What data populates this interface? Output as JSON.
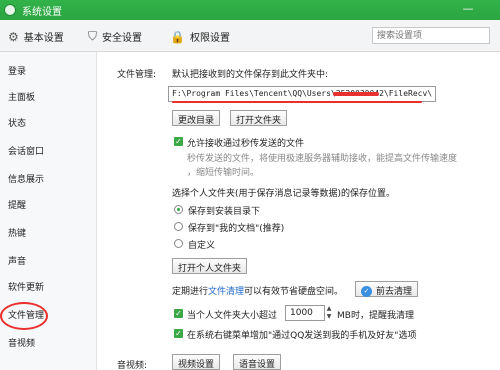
{
  "window": {
    "title": "系统设置",
    "minimize": "—"
  },
  "tabs": [
    {
      "label": "基本设置",
      "icon": "gear-icon"
    },
    {
      "label": "安全设置",
      "icon": "shield-icon"
    },
    {
      "label": "权限设置",
      "icon": "lock-icon"
    }
  ],
  "search": {
    "placeholder": "搜索设置项"
  },
  "sidebar": {
    "items": [
      {
        "label": "登录"
      },
      {
        "label": "主面板"
      },
      {
        "label": "状态"
      },
      {
        "label": "会话窗口"
      },
      {
        "label": "信息展示"
      },
      {
        "label": "提醒"
      },
      {
        "label": "热键"
      },
      {
        "label": "声音"
      },
      {
        "label": "软件更新"
      },
      {
        "label": "文件管理"
      },
      {
        "label": "音视频"
      }
    ],
    "selected": "文件管理"
  },
  "file_mgmt": {
    "section_label": "文件管理:",
    "save_desc": "默认把接收到的文件保存到此文件夹中:",
    "path": "F:\\Program Files\\Tencent\\QQ\\Users\\2530030042\\FileRecv\\",
    "change_dir": "更改目录",
    "open_folder": "打开文件夹",
    "allow_offline": "允许接收通过秒传发送的文件",
    "offline_desc_1": "秒传发送的文件，将使用极速服务器辅助接收，能提高文件传输速度",
    "offline_desc_2": "，缩短传输时间。",
    "personal_folder_desc": "选择个人文件夹(用于保存消息记录等数据)的保存位置。",
    "radio_1": "保存到安装目录下",
    "radio_2": "保存到\"我的文档\"(推荐)",
    "radio_3": "自定义",
    "open_personal": "打开个人文件夹",
    "clean_prefix": "定期进行",
    "clean_link": "文件清理",
    "clean_suffix": "可以有效节省硬盘空间。",
    "clean_button": "前去清理",
    "size_prefix": "当个人文件夹大小超过",
    "size_value": "1000",
    "size_suffix": "MB时，提醒我清理",
    "right_click": "在系统右键菜单增加\"通过QQ发送到我的手机及好友\"选项"
  },
  "av": {
    "label": "音视频:",
    "video_btn": "视频设置",
    "audio_btn": "语音设置"
  },
  "colors": {
    "titlebar": "#2aa541",
    "annotation": "#e8302e",
    "link": "#1a66c9"
  }
}
